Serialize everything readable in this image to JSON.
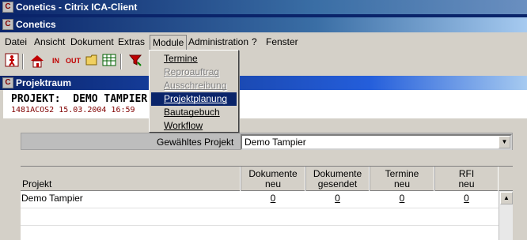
{
  "outer_window": {
    "title": "Conetics - Citrix ICA-Client"
  },
  "inner_window": {
    "title": "Conetics"
  },
  "menubar": [
    "Datei",
    "Ansicht",
    "Dokument",
    "Extras",
    "Module",
    "Administration",
    "?",
    "Fenster"
  ],
  "toolbar": {
    "in_label": "IN",
    "out_label": "OUT"
  },
  "module_menu": {
    "items": [
      {
        "label": "Termine",
        "state": "enabled"
      },
      {
        "label": "Reproauftrag",
        "state": "disabled"
      },
      {
        "label": "Ausschreibung",
        "state": "disabled"
      },
      {
        "label": "Projektplanung",
        "state": "selected"
      },
      {
        "label": "Bautagebuch",
        "state": "enabled"
      },
      {
        "label": "Workflow",
        "state": "enabled"
      }
    ]
  },
  "panel": {
    "title": "Projektraum",
    "project_heading": "PROJEKT:  DEMO TAMPIER",
    "project_sub": "1481ACOS2 15.03.2004 16:59"
  },
  "filter": {
    "label": "Gewähltes Projekt",
    "selected": "Demo Tampier"
  },
  "grid": {
    "columns": [
      {
        "line1": "",
        "line2": "Projekt"
      },
      {
        "line1": "Dokumente",
        "line2": "neu"
      },
      {
        "line1": "Dokumente",
        "line2": "gesendet"
      },
      {
        "line1": "Termine",
        "line2": "neu"
      },
      {
        "line1": "RFI",
        "line2": "neu"
      }
    ],
    "rows": [
      {
        "name": "Demo Tampier",
        "docs_new": "0",
        "docs_sent": "0",
        "termine_new": "0",
        "rfi_new": "0"
      }
    ]
  },
  "colors": {
    "title_bar": "#0a246a",
    "menu_highlight": "#0a246a",
    "project_sub": "#800000",
    "face": "#d4d0c8"
  }
}
